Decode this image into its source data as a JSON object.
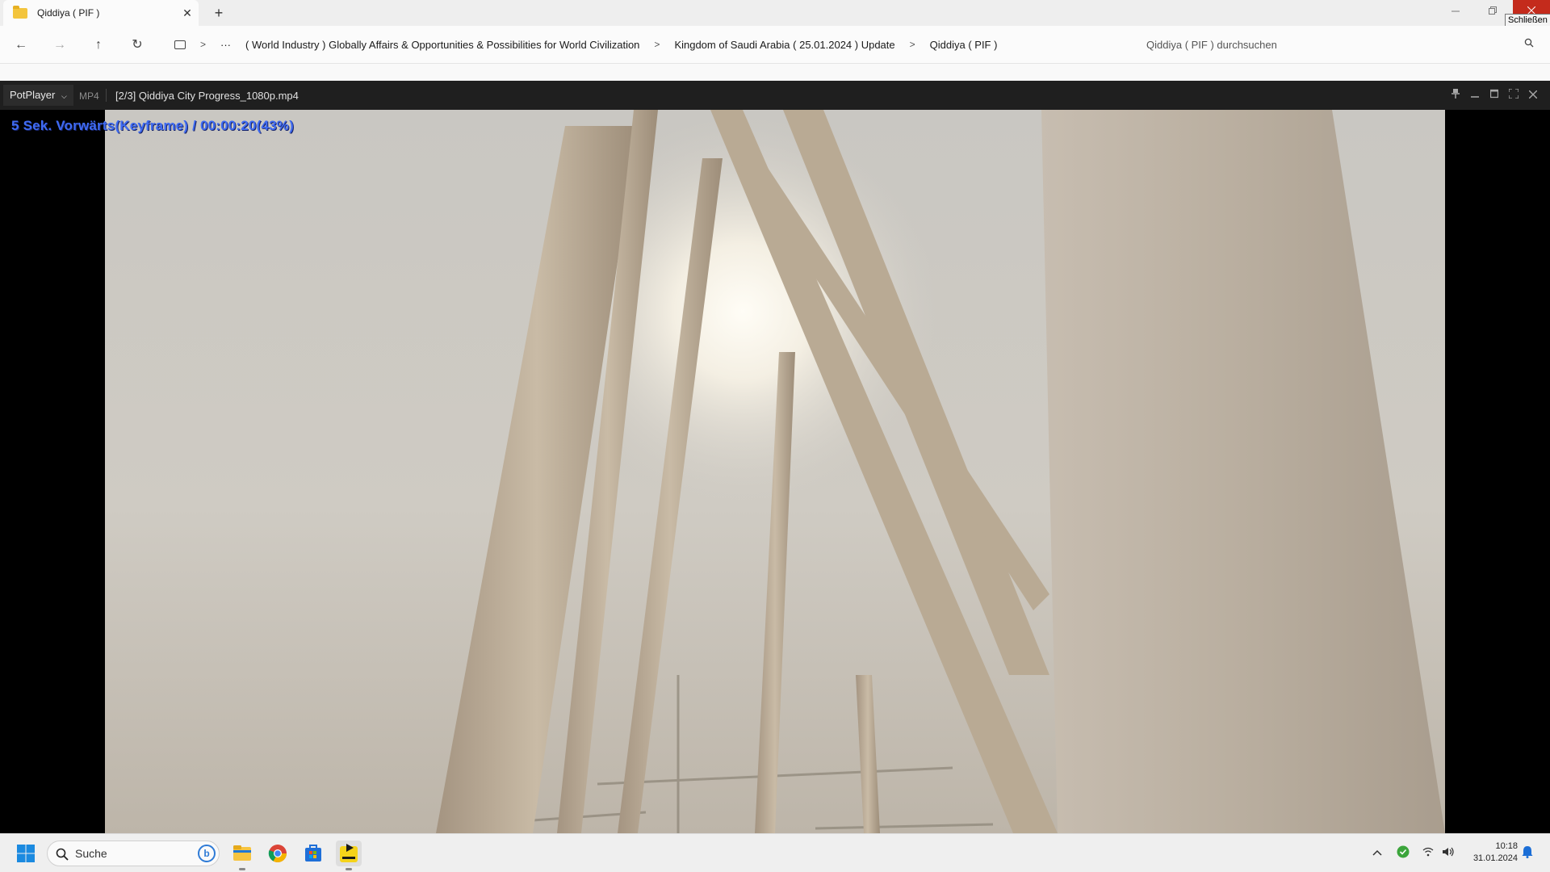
{
  "explorer": {
    "tab_title": "Qiddiya ( PIF )",
    "tab_close": "✕",
    "new_tab": "+",
    "window_close_tooltip": "Schließen",
    "nav": {
      "back": "←",
      "forward": "→",
      "up": "↑",
      "refresh": "↻",
      "more": "···"
    },
    "breadcrumbs": [
      "( World Industry ) Globally Affairs & Opportunities & Possibilities for World Civilization",
      "Kingdom of Saudi Arabia ( 25.01.2024 ) Update",
      "Qiddiya ( PIF )"
    ],
    "search_placeholder": "Qiddiya ( PIF ) durchsuchen"
  },
  "player": {
    "menu_label": "PotPlayer",
    "format": "MP4",
    "file_title": "[2/3] Qiddiya City Progress_1080p.mp4",
    "osd_text": "5  Sek. Vorwärts(Keyframe) / 00:00:20(43%)"
  },
  "taskbar": {
    "search_label": "Suche",
    "bing_label": "b",
    "time": "10:18",
    "date": "31.01.2024",
    "apps": [
      "file-explorer",
      "chrome",
      "microsoft-store",
      "potplayer"
    ]
  }
}
